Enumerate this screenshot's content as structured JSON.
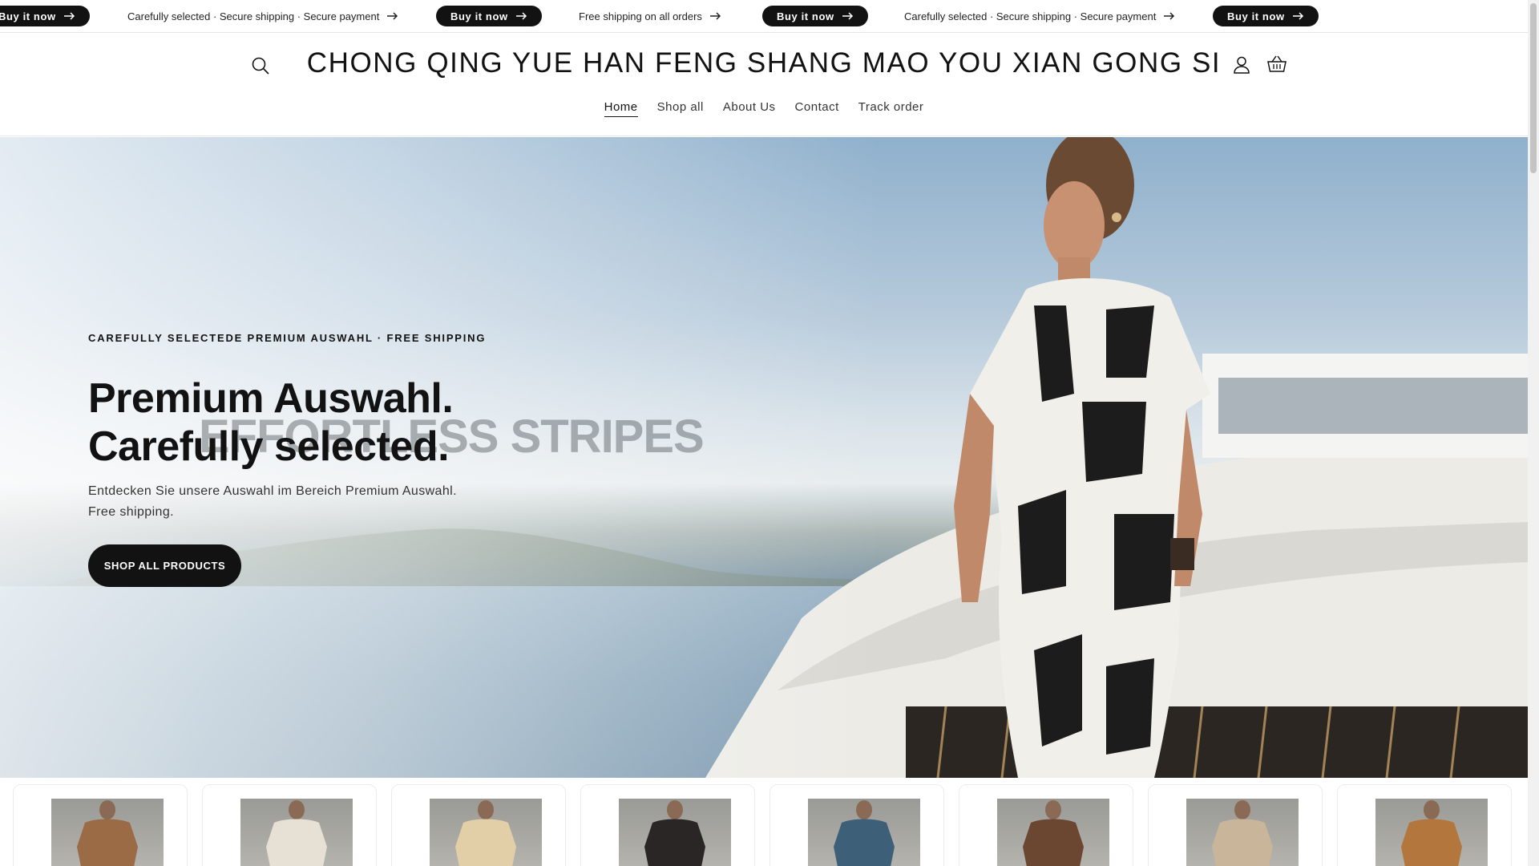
{
  "announcement": {
    "items": [
      {
        "type": "pill",
        "text": "Buy it now"
      },
      {
        "type": "text",
        "text": "Carefully selected · Secure shipping · Secure payment"
      },
      {
        "type": "pill",
        "text": "Buy it now"
      },
      {
        "type": "text",
        "text": "Free shipping on all orders"
      },
      {
        "type": "pill",
        "text": "Buy it now"
      },
      {
        "type": "text",
        "text": "Carefully selected · Secure shipping · Secure payment"
      },
      {
        "type": "pill",
        "text": "Buy it now"
      }
    ]
  },
  "header": {
    "brand": "CHONG QING YUE HAN FENG SHANG MAO YOU XIAN GONG SI",
    "search_icon": "search-icon",
    "account_icon": "account-icon",
    "cart_icon": "cart-icon"
  },
  "nav": {
    "items": [
      {
        "label": "Home",
        "active": true
      },
      {
        "label": "Shop all",
        "active": false
      },
      {
        "label": "About Us",
        "active": false
      },
      {
        "label": "Contact",
        "active": false
      },
      {
        "label": "Track order",
        "active": false
      }
    ]
  },
  "hero": {
    "kicker": "CAREFULLY SELECTEDE PREMIUM AUSWAHL · FREE SHIPPING",
    "title_line1": "Premium Auswahl.",
    "title_line2": "Carefully selected.",
    "watermark": "EFFORTLESS STRIPES",
    "subtitle_line1": "Entdecken Sie unsere Auswahl im Bereich Premium Auswahl.",
    "subtitle_line2": "Free shipping.",
    "cta": "SHOP ALL PRODUCTS"
  },
  "products": {
    "colors": [
      "#9a6b45",
      "#e7e0d4",
      "#e2cfa8",
      "#2a2626",
      "#3d5f78",
      "#6b4630",
      "#c8b59a",
      "#b3773d"
    ]
  },
  "colors": {
    "primary": "#121212",
    "border": "#e6e6e6"
  }
}
